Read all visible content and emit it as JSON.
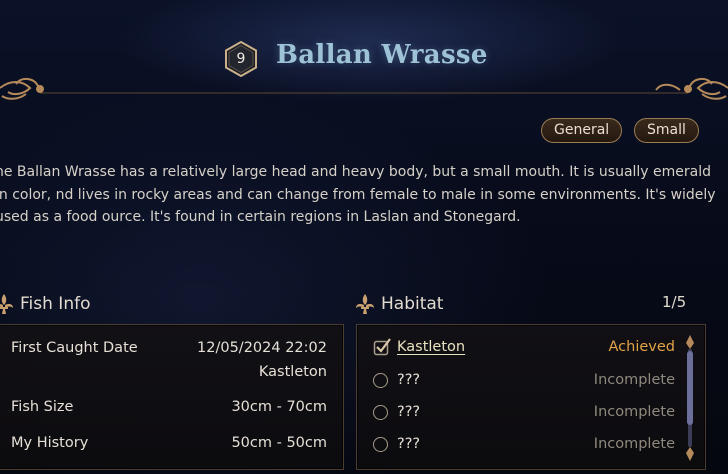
{
  "header": {
    "level": "9",
    "fish_name": "Ballan Wrasse"
  },
  "tags": [
    "General",
    "Small"
  ],
  "description": "he Ballan Wrasse has a relatively large head and heavy body, but a small mouth. It is usually emerald in color, nd lives in rocky areas and can change from female to male in some environments. It's widely used as a food ource. It's found in certain regions in Laslan and Stonegard.",
  "fish_info": {
    "title": "Fish Info",
    "first_caught_label": "First Caught Date",
    "first_caught_value": "12/05/2024 22:02",
    "first_caught_location": "Kastleton",
    "size_label": "Fish Size",
    "size_value": "30cm - 70cm",
    "history_label": "My History",
    "history_value": "50cm - 50cm"
  },
  "habitat": {
    "title": "Habitat",
    "count": "1/5",
    "items": [
      {
        "name": "Kastleton",
        "status": "Achieved"
      },
      {
        "name": "???",
        "status": "Incomplete"
      },
      {
        "name": "???",
        "status": "Incomplete"
      },
      {
        "name": "???",
        "status": "Incomplete"
      }
    ]
  },
  "colors": {
    "title_blue": "#9fc3d6",
    "achieved_orange": "#e1a347",
    "incomplete_gray": "#8f887e",
    "gold_ornament": "#b58a5a"
  },
  "icons": {
    "level_badge": "hexagon-badge-icon",
    "section": "fleur-de-lis-icon",
    "achieved": "checkmark-box-icon",
    "incomplete": "radio-circle-icon"
  }
}
